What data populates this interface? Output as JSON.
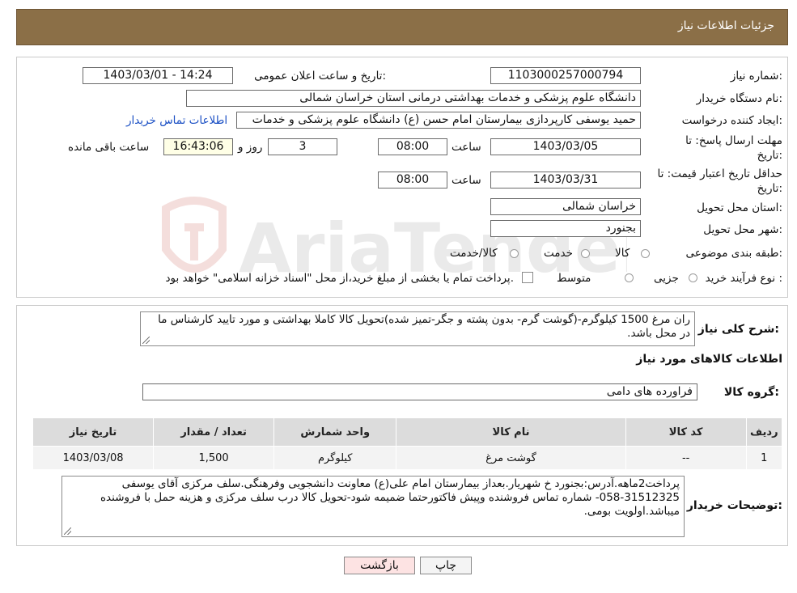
{
  "header": {
    "title": "جزئیات اطلاعات نیاز"
  },
  "fields": {
    "need_number_label": "شماره نیاز:",
    "need_number": "1103000257000794",
    "announce_label": "تاریخ و ساعت اعلان عمومی:",
    "announce_value": "1403/03/01 - 14:24",
    "buyer_org_label": "نام دستگاه خریدار:",
    "buyer_org": "دانشگاه علوم پزشکی و خدمات بهداشتی درمانی استان خراسان شمالی",
    "creator_label": "ایجاد کننده درخواست:",
    "creator": "حمید یوسفی کارپردازی بیمارستان امام حسن (ع) دانشگاه علوم پزشکی و خدمات",
    "contact_link": "اطلاعات تماس خریدار",
    "deadline_label": "مهلت ارسال پاسخ: تا تاریخ:",
    "deadline_date": "1403/03/05",
    "time_label": "ساعت",
    "deadline_time": "08:00",
    "days_value": "3",
    "days_label": "روز و",
    "remaining_time": "16:43:06",
    "remaining_label": "ساعت باقی مانده",
    "validity_label": "حداقل تاریخ اعتبار قیمت: تا تاریخ:",
    "validity_date": "1403/03/31",
    "validity_time": "08:00",
    "province_label": "استان محل تحویل:",
    "province": "خراسان شمالی",
    "city_label": "شهر محل تحویل:",
    "city": "بجنورد",
    "category_label": "طبقه بندی موضوعی:",
    "cat_options": [
      "کالا",
      "خدمت",
      "کالا/خدمت"
    ],
    "process_label": "نوع فرآیند خرید :",
    "process_options": [
      "جزیی",
      "متوسط"
    ],
    "process_note": "پرداخت تمام یا بخشی از مبلغ خرید،از محل \"اسناد خزانه اسلامی\" خواهد بود."
  },
  "description": {
    "label": "شرح کلی نیاز:",
    "text": "ران مرغ 1500 کیلوگرم-(گوشت گرم- بدون پشته و جگر-تمیز شده)تحویل کالا کاملا بهداشتی و مورد تایید کارشناس ما در محل باشد."
  },
  "goods": {
    "section_title": "اطلاعات کالاهای مورد نیاز",
    "group_label": "گروه کالا:",
    "group_value": "فراورده های دامی",
    "columns": [
      "ردیف",
      "کد کالا",
      "نام کالا",
      "واحد شمارش",
      "تعداد / مقدار",
      "تاریخ نیاز"
    ],
    "rows": [
      [
        "1",
        "--",
        "گوشت مرغ",
        "کیلوگرم",
        "1,500",
        "1403/03/08"
      ]
    ]
  },
  "buyer_notes": {
    "label": "توضیحات خریدار:",
    "text": "پرداخت2ماهه.آدرس:بجنورد خ شهریار.بعداز بیمارستان امام علی(ع) معاونت دانشجویی وفرهنگی.سلف مرکزی آقای یوسفی 31512325-058- شماره تماس فروشنده وپیش فاکتورحتما ضمیمه شود-تحویل کالا درب سلف مرکزی و هزینه حمل با فروشنده میباشد.اولویت بومی."
  },
  "buttons": {
    "print": "چاپ",
    "back": "بازگشت"
  },
  "watermark": {
    "text": "AriaTender.neT"
  },
  "colors": {
    "header_bg": "#8b6f47",
    "link": "#1a4fc4",
    "back_btn_bg": "#fde3e3"
  }
}
